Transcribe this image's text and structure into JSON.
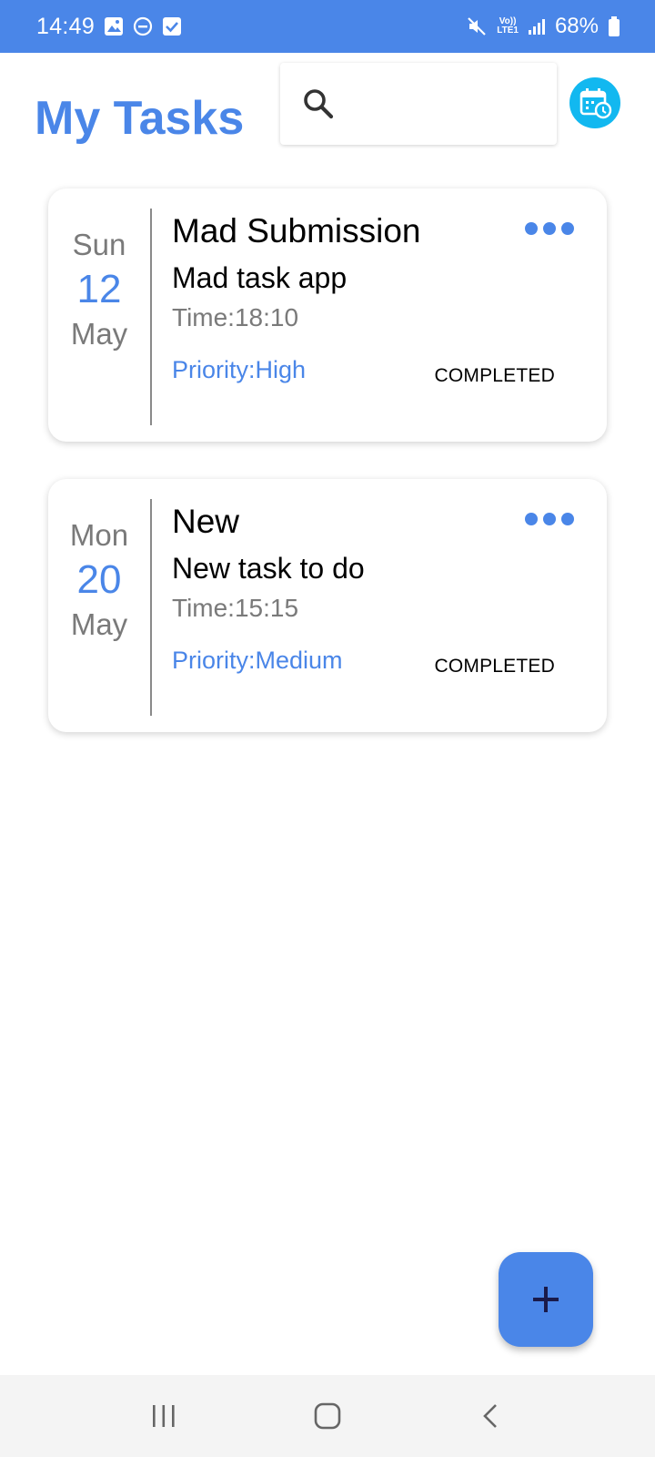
{
  "status_bar": {
    "time": "14:49",
    "battery": "68%",
    "network_top": "Vo))",
    "network_bottom": "LTE1",
    "bg_color": "#4a86e8"
  },
  "header": {
    "title": "My Tasks",
    "search": {
      "placeholder": "",
      "value": ""
    },
    "calendar_icon": "calendar-alarm-icon",
    "accent_color": "#4a86e8"
  },
  "tasks": [
    {
      "day": "Sun",
      "date": "12",
      "month": "May",
      "title": "Mad Submission",
      "description": "Mad task app",
      "time": "Time:18:10",
      "priority": "Priority:High",
      "status": "COMPLETED"
    },
    {
      "day": "Mon",
      "date": "20",
      "month": "May",
      "title": "New",
      "description": "New task to do",
      "time": "Time:15:15",
      "priority": "Priority:Medium",
      "status": "COMPLETED"
    }
  ],
  "fab": {
    "icon": "plus-icon"
  },
  "nav": {
    "recent_icon": "recent-apps-icon",
    "home_icon": "home-icon",
    "back_icon": "back-icon"
  }
}
